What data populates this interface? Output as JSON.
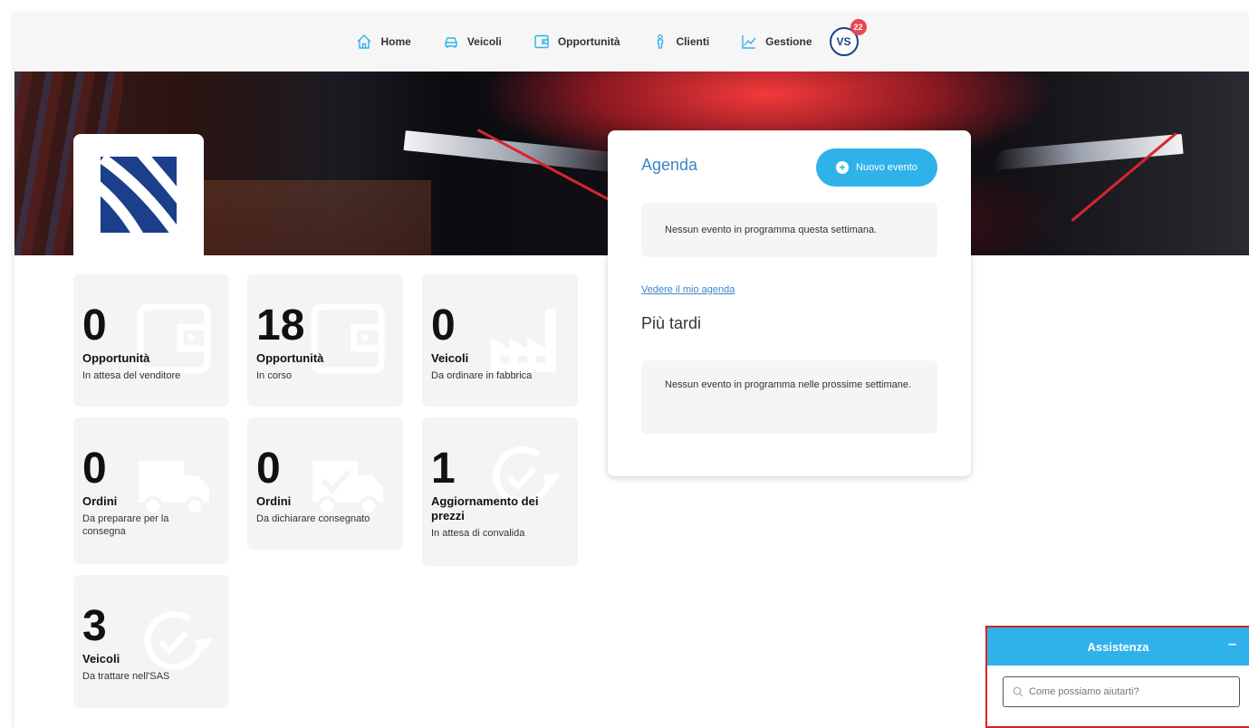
{
  "nav": {
    "items": [
      {
        "label": "Home",
        "icon": "home-icon"
      },
      {
        "label": "Veicoli",
        "icon": "car-icon"
      },
      {
        "label": "Opportunità",
        "icon": "wallet-icon"
      },
      {
        "label": "Clienti",
        "icon": "person-icon"
      },
      {
        "label": "Gestione",
        "icon": "chart-line-icon"
      }
    ],
    "avatar": {
      "initials": "VS",
      "badge": "22"
    }
  },
  "tiles": [
    {
      "number": "0",
      "title": "Opportunità",
      "subtitle": "In attesa del venditore",
      "icon": "wallet-icon"
    },
    {
      "number": "18",
      "title": "Opportunità",
      "subtitle": "In corso",
      "icon": "wallet-icon"
    },
    {
      "number": "0",
      "title": "Veicoli",
      "subtitle": "Da ordinare in fabbrica",
      "icon": "factory-icon"
    },
    {
      "number": "0",
      "title": "Ordini",
      "subtitle": "Da preparare per la consegna",
      "icon": "truck-icon"
    },
    {
      "number": "0",
      "title": "Ordini",
      "subtitle": "Da dichiarare consegnato",
      "icon": "truck-check-icon"
    },
    {
      "number": "1",
      "title": "Aggiornamento dei prezzi",
      "subtitle": "In attesa di convalida",
      "icon": "refresh-check-icon"
    },
    {
      "number": "3",
      "title": "Veicoli",
      "subtitle": "Da trattare nell'SAS",
      "icon": "refresh-check-icon"
    }
  ],
  "agenda": {
    "title": "Agenda",
    "new_event_label": "Nuovo evento",
    "empty_week": "Nessun evento in programma questa settimana.",
    "link": "Vedere il mio agenda",
    "later_title": "Più tardi",
    "empty_later": "Nessun evento in programma nelle prossime settimane."
  },
  "assist": {
    "title": "Assistenza",
    "minimize": "–",
    "placeholder": "Come possiamo aiutarti?"
  },
  "colors": {
    "accent": "#2fb2ea",
    "link": "#3d86c6",
    "brand": "#1b3f8a",
    "badge": "#e8494f",
    "highlight_border": "#d9202a"
  }
}
